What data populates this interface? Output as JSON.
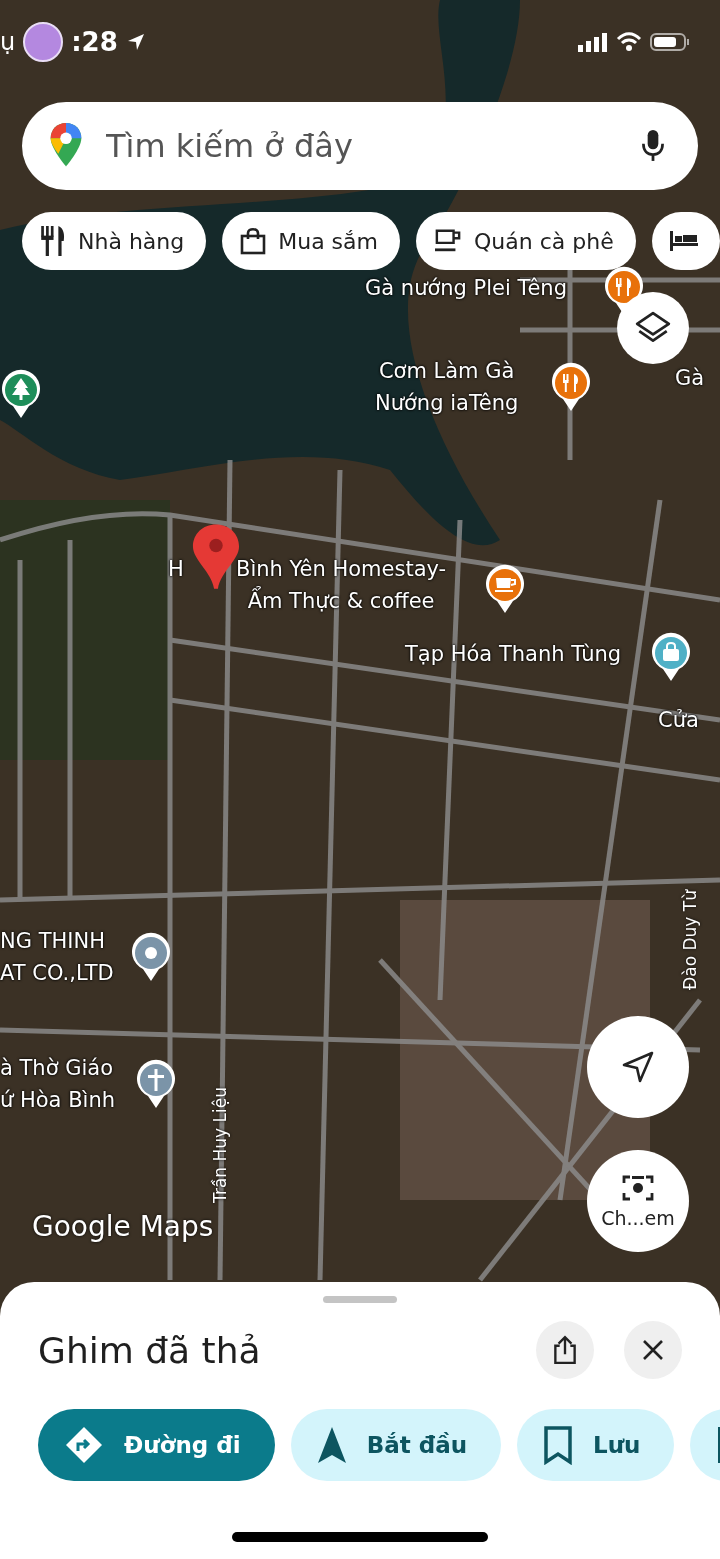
{
  "status_bar": {
    "carrier_fragment": "ụ",
    "time": ":28"
  },
  "search": {
    "placeholder": "Tìm kiếm ở đây"
  },
  "chips": [
    {
      "label": "Nhà hàng",
      "kind": "restaurant"
    },
    {
      "label": "Mua sắm",
      "kind": "shopping"
    },
    {
      "label": "Quán cà phê",
      "kind": "cafe"
    },
    {
      "kind": "hotel"
    }
  ],
  "map": {
    "places": [
      {
        "lines": [
          "Gà nướng Plei Têng"
        ],
        "kind": "restaurant"
      },
      {
        "lines": [
          "Cơm Làm Gà",
          "Nướng iaTêng"
        ],
        "kind": "restaurant"
      },
      {
        "lines": [
          "Gà"
        ]
      },
      {
        "kind": "park"
      },
      {
        "cut_prefix": "H",
        "lines": [
          "Bình Yên Homestay-",
          "Ẩm Thực & coffee"
        ],
        "kind": "cafe"
      },
      {
        "lines": [
          "Tạp Hóa Thanh Tùng"
        ],
        "kind": "shopping"
      },
      {
        "lines": [
          "Cửa"
        ]
      },
      {
        "lines": [
          "NG THINH",
          "AT CO.,LTD"
        ],
        "kind": "generic"
      },
      {
        "lines": [
          "à Thờ Giáo",
          "ứ Hòa Bình"
        ],
        "kind": "church"
      }
    ],
    "streets": [
      "Trần Huy Liệu",
      "Đào Duy Từ"
    ],
    "logo": "Google Maps",
    "camera_label": "Ch...em"
  },
  "sheet": {
    "title": "Ghim đã thả",
    "actions": [
      {
        "label": "Đường đi",
        "kind": "directions"
      },
      {
        "label": "Bắt đầu",
        "kind": "start"
      },
      {
        "label": "Lưu",
        "kind": "save"
      },
      {
        "kind": "flag"
      }
    ]
  }
}
